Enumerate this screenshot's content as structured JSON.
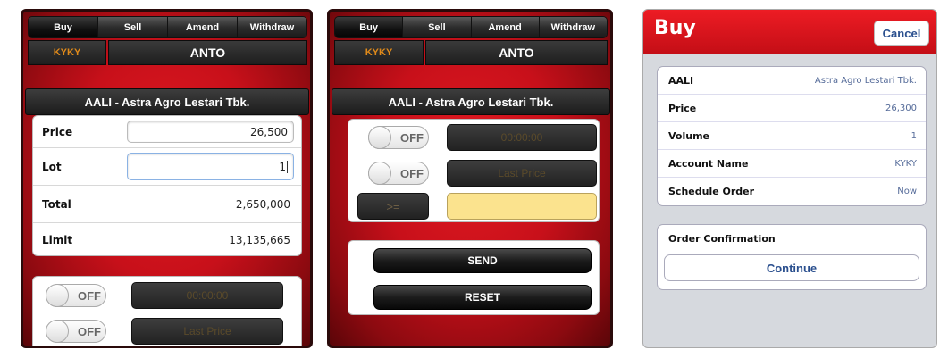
{
  "tabs": [
    "Buy",
    "Sell",
    "Amend",
    "Withdraw"
  ],
  "account": {
    "code": "KYKY",
    "name": "ANTO"
  },
  "stock": "AALI - Astra Agro Lestari Tbk.",
  "form": {
    "price_label": "Price",
    "price_value": "26,500",
    "lot_label": "Lot",
    "lot_value": "1",
    "total_label": "Total",
    "total_value": "2,650,000",
    "limit_label": "Limit",
    "limit_value": "13,135,665"
  },
  "schedule": {
    "off_label": "OFF",
    "time_placeholder": "00:00:00",
    "price_placeholder": "Last Price",
    "operator": ">="
  },
  "actions": {
    "send": "SEND",
    "reset": "RESET"
  },
  "confirm": {
    "title": "Buy",
    "cancel": "Cancel",
    "rows": [
      {
        "label": "AALI",
        "value": "Astra Agro Lestari Tbk."
      },
      {
        "label": "Price",
        "value": "26,300"
      },
      {
        "label": "Volume",
        "value": "1"
      },
      {
        "label": "Account Name",
        "value": "KYKY"
      },
      {
        "label": "Schedule Order",
        "value": "Now"
      }
    ],
    "order_confirmation": "Order Confirmation",
    "continue": "Continue"
  },
  "colors": {
    "red": "#e01a22",
    "account_orange": "#e08a1a",
    "link_blue": "#2a4f8e"
  }
}
